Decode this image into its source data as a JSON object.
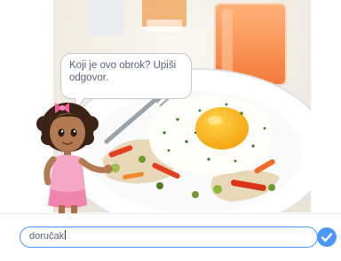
{
  "prompt": {
    "line1": "Koji je ovo obrok? Upiši",
    "line2": "odgovor."
  },
  "answer": {
    "value": "doručak"
  },
  "icons": {
    "submit": "checkmark-icon"
  },
  "colors": {
    "accent": "#4c97ff",
    "bubble_text": "#575e75"
  }
}
